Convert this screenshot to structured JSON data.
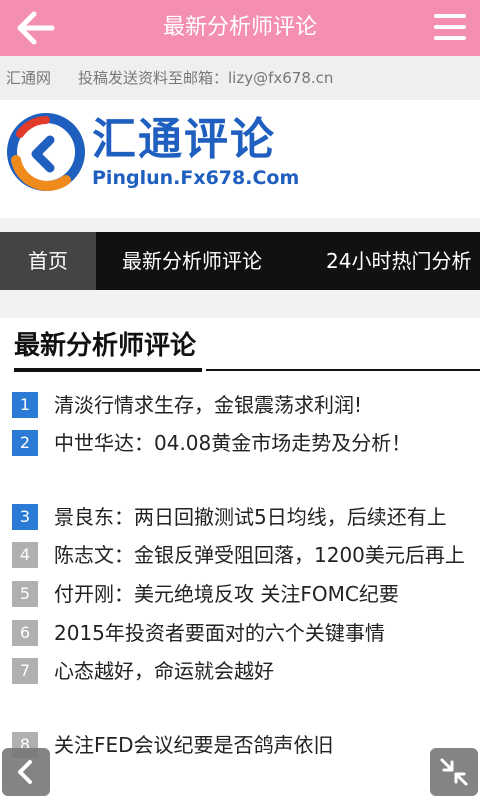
{
  "header": {
    "title": "最新分析师评论"
  },
  "infobar": {
    "site": "汇通网",
    "contact": "投稿发送资料至邮箱：lizy@fx678.cn"
  },
  "logo": {
    "name_cn": "汇通评论",
    "name_en": "Pinglun.Fx678.Com"
  },
  "nav": {
    "home": "首页",
    "latest": "最新分析师评论",
    "hot": "24小时热门分析"
  },
  "section": {
    "title": "最新分析师评论"
  },
  "articles": [
    {
      "num": "1",
      "title": "清淡行情求生存，金银震荡求利润!"
    },
    {
      "num": "2",
      "title": "中世华达：04.08黄金市场走势及分析！"
    },
    {
      "num": "3",
      "title": "景良东：两日回撤测试5日均线，后续还有上"
    },
    {
      "num": "4",
      "title": "陈志文：金银反弹受阻回落，1200美元后再上"
    },
    {
      "num": "5",
      "title": "付开刚：美元绝境反攻 关注FOMC纪要"
    },
    {
      "num": "6",
      "title": "2015年投资者要面对的六个关键事情"
    },
    {
      "num": "7",
      "title": "心态越好，命运就会越好"
    },
    {
      "num": "8",
      "title": "关注FED会议纪要是否鸽声依旧"
    }
  ],
  "colors": {
    "header_bg": "#f48fb1",
    "highlight_badge": "#2b7bd6",
    "normal_badge": "#b0b0b0",
    "logo_text": "#1f5fbf"
  }
}
